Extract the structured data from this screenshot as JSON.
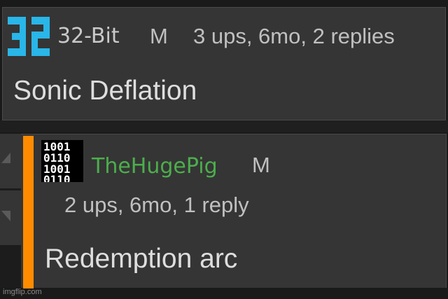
{
  "comment": {
    "username": "32-Bit",
    "badge": "M",
    "stats": "3 ups, 6mo, 2 replies",
    "text": "Sonic Deflation",
    "avatar_icon": "32-bit-logo-icon",
    "avatar_color": "#29b6e8"
  },
  "reply": {
    "username": "TheHugePig",
    "badge": "M",
    "stats": "2 ups, 6mo, 1 reply",
    "text": "Redemption arc",
    "avatar_icon": "binary-code-icon",
    "username_color": "#4cae4c",
    "thread_color": "#ff8c00"
  },
  "vote": {
    "up_icon": "triangle-up-icon",
    "down_icon": "triangle-down-icon"
  },
  "watermark": "imgflip.com"
}
